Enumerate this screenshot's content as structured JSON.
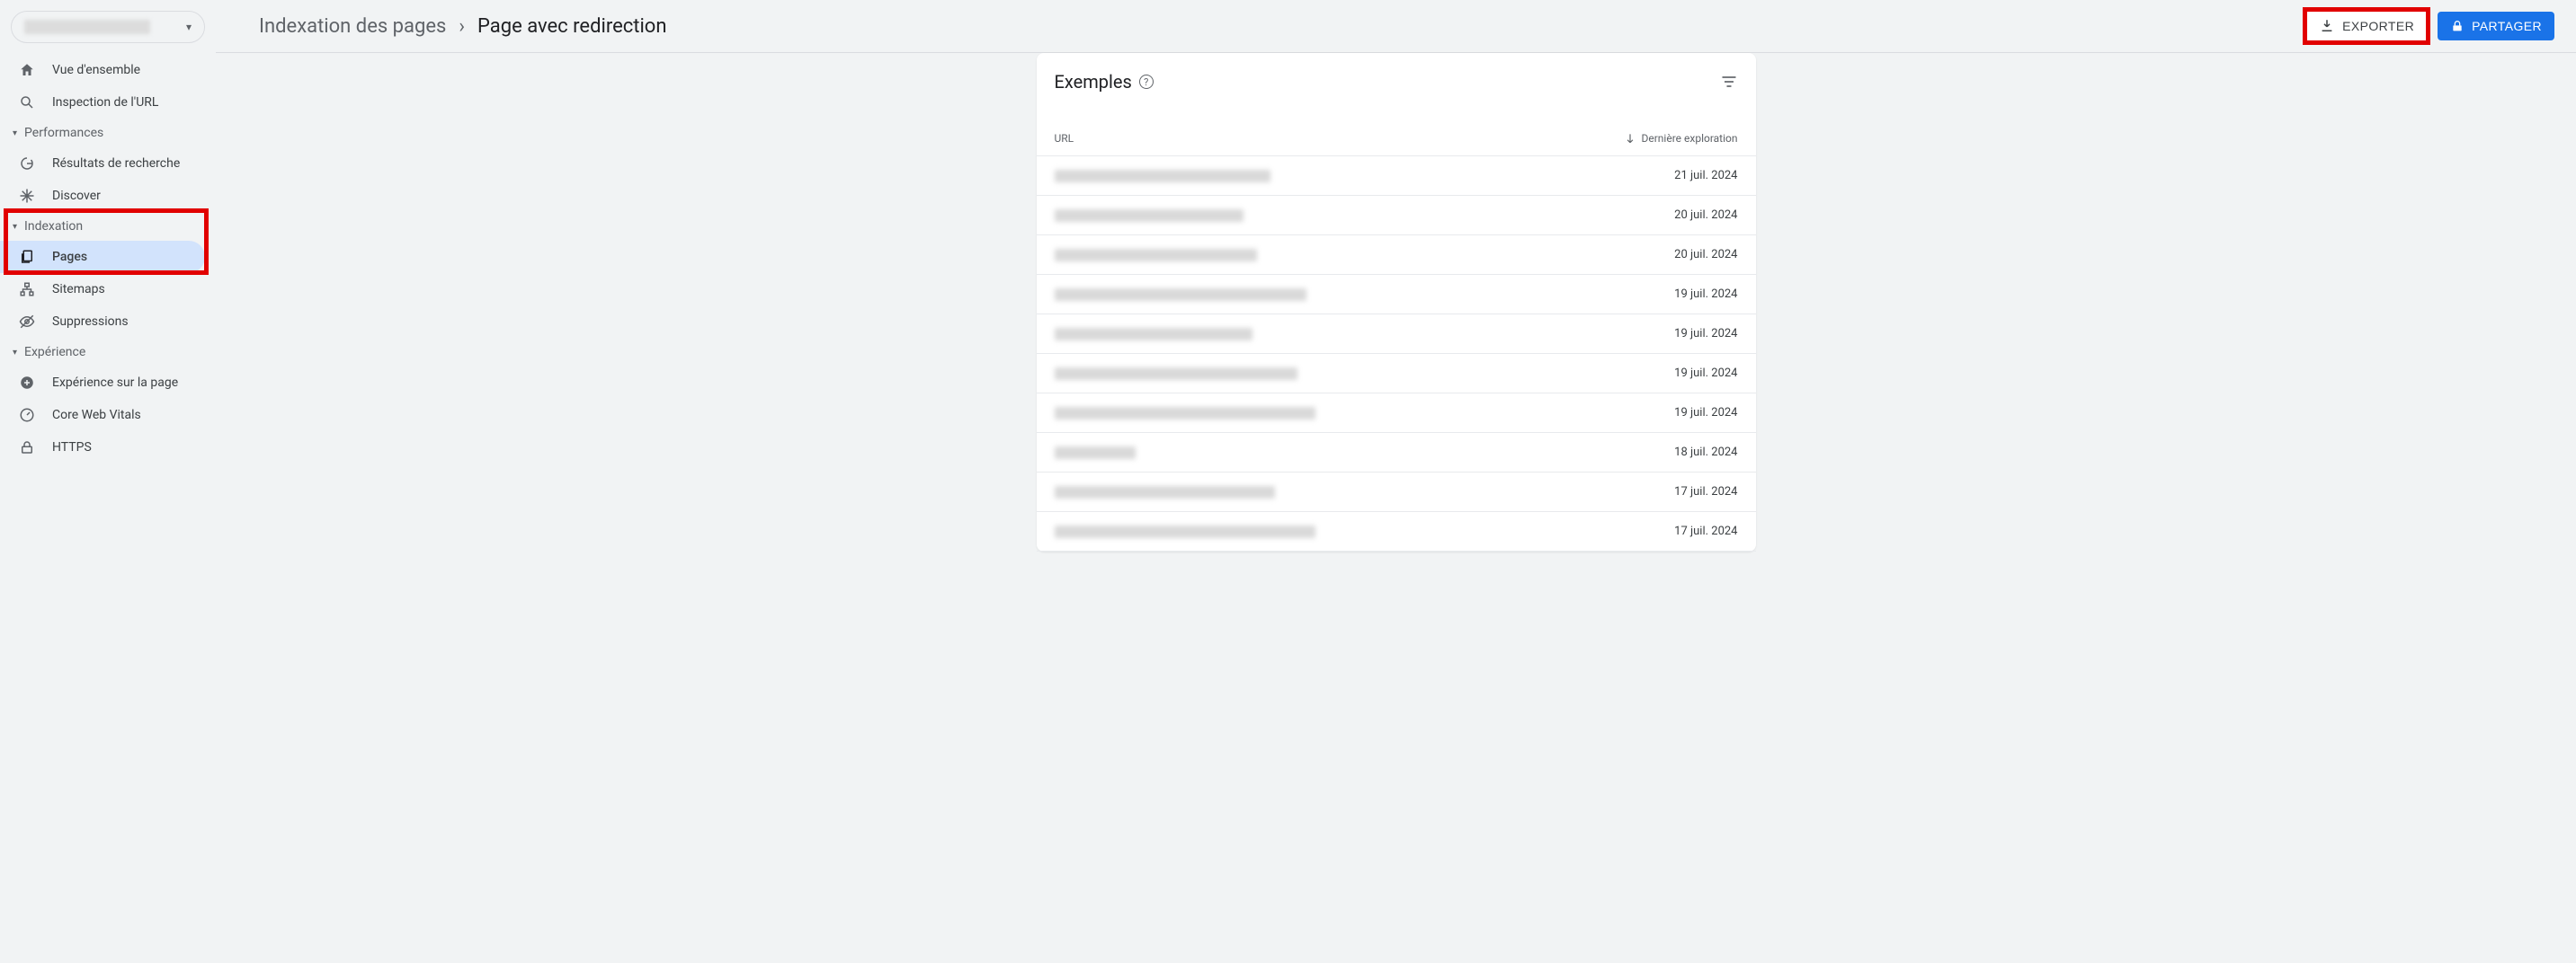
{
  "sidebar": {
    "property_placeholder": "",
    "items": [
      {
        "label": "Vue d'ensemble"
      },
      {
        "label": "Inspection de l'URL"
      }
    ],
    "groups": [
      {
        "label": "Performances",
        "items": [
          {
            "label": "Résultats de recherche"
          },
          {
            "label": "Discover"
          }
        ]
      },
      {
        "label": "Indexation",
        "items": [
          {
            "label": "Pages"
          },
          {
            "label": "Sitemaps"
          },
          {
            "label": "Suppressions"
          }
        ]
      },
      {
        "label": "Expérience",
        "items": [
          {
            "label": "Expérience sur la page"
          },
          {
            "label": "Core Web Vitals"
          },
          {
            "label": "HTTPS"
          }
        ]
      }
    ]
  },
  "breadcrumb": {
    "parent": "Indexation des pages",
    "current": "Page avec redirection"
  },
  "actions": {
    "export": "EXPORTER",
    "share": "PARTAGER"
  },
  "card": {
    "title": "Exemples",
    "columns": {
      "url": "URL",
      "date": "Dernière exploration"
    },
    "rows": [
      {
        "url_width": 240,
        "date": "21 juil. 2024"
      },
      {
        "url_width": 210,
        "date": "20 juil. 2024"
      },
      {
        "url_width": 225,
        "date": "20 juil. 2024"
      },
      {
        "url_width": 280,
        "date": "19 juil. 2024"
      },
      {
        "url_width": 220,
        "date": "19 juil. 2024"
      },
      {
        "url_width": 270,
        "date": "19 juil. 2024"
      },
      {
        "url_width": 290,
        "date": "19 juil. 2024"
      },
      {
        "url_width": 90,
        "date": "18 juil. 2024"
      },
      {
        "url_width": 245,
        "date": "17 juil. 2024"
      },
      {
        "url_width": 290,
        "date": "17 juil. 2024"
      }
    ]
  }
}
